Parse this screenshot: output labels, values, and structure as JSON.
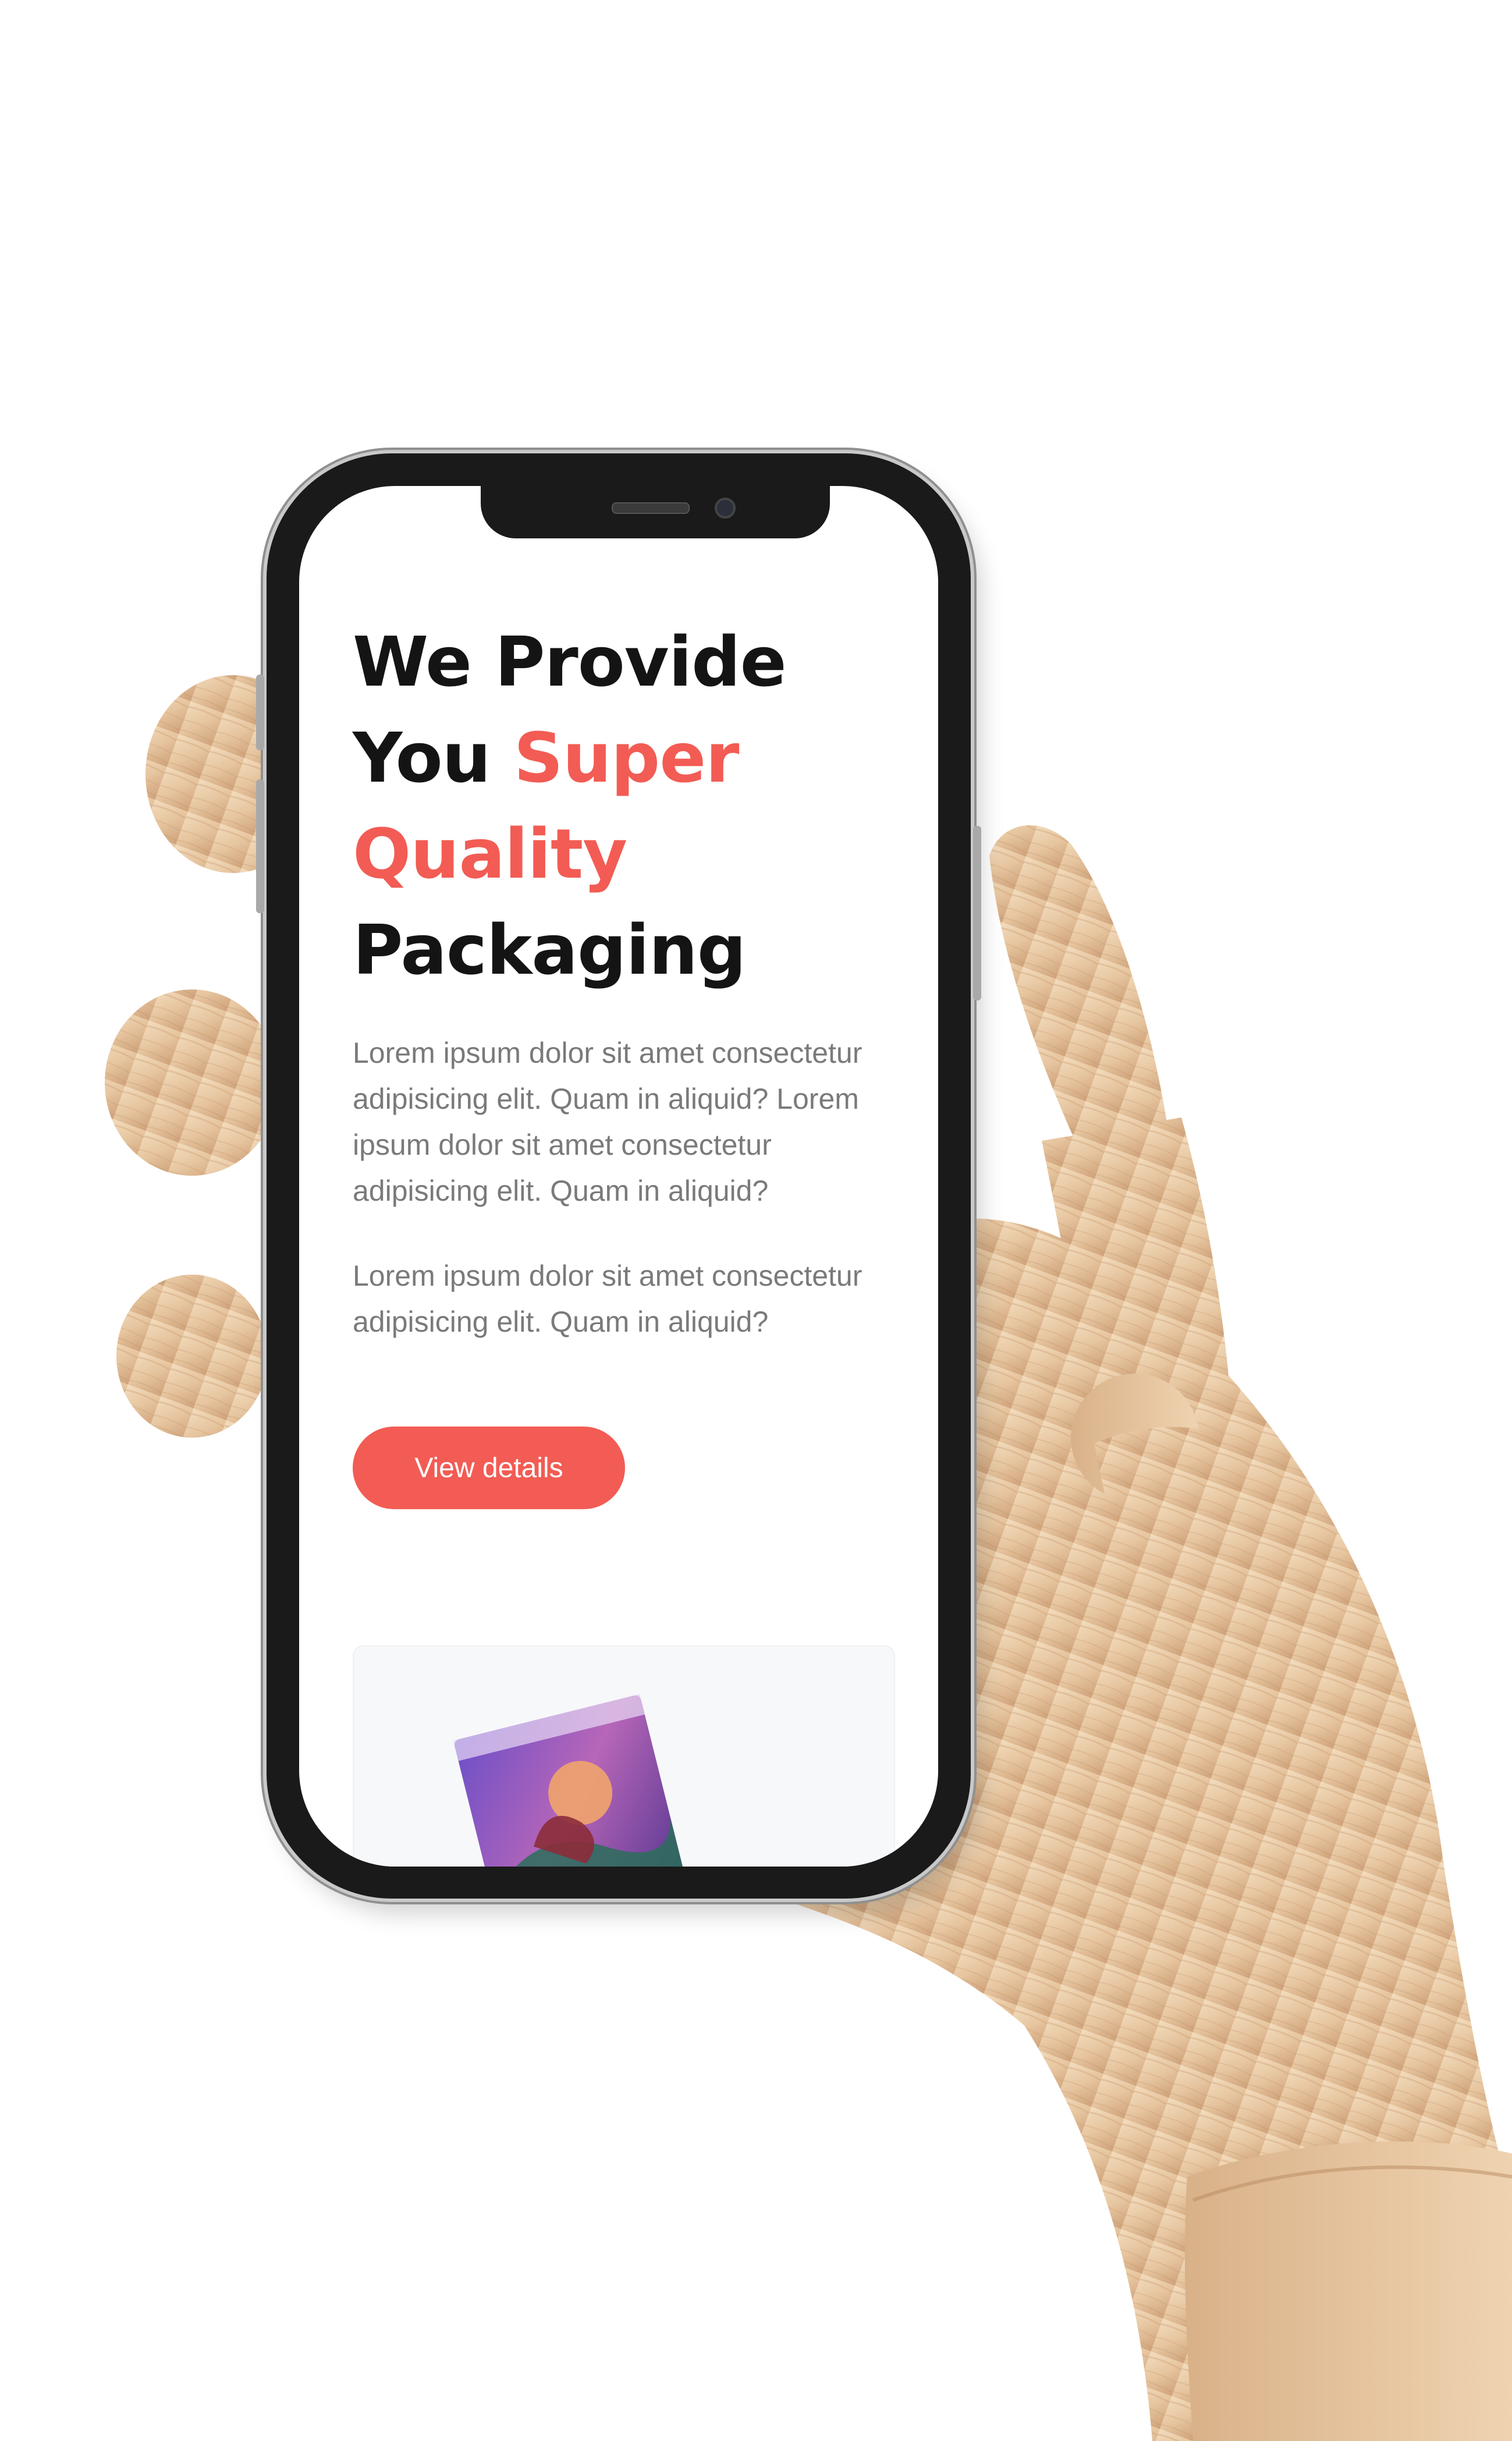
{
  "hero": {
    "headline_line1": "We Provide",
    "headline_line2_prefix": "You ",
    "headline_accent_1": "Super",
    "headline_accent_2": "Quality",
    "headline_line4": "Packaging",
    "paragraph_1": "Lorem ipsum dolor sit amet consectetur adipisicing elit. Quam in aliquid? Lorem ipsum dolor sit amet consectetur adipisicing elit. Quam in aliquid?",
    "paragraph_2": "Lorem ipsum dolor sit amet consectetur adipisicing elit. Quam in aliquid?",
    "cta_label": "View details"
  },
  "colors": {
    "accent": "#f25c54",
    "headline": "#141414",
    "body_text": "#7a7a7a",
    "wood": "#e8c9a3"
  },
  "icons": {
    "camera": "front-camera-icon",
    "speaker": "earpiece-speaker-icon"
  }
}
